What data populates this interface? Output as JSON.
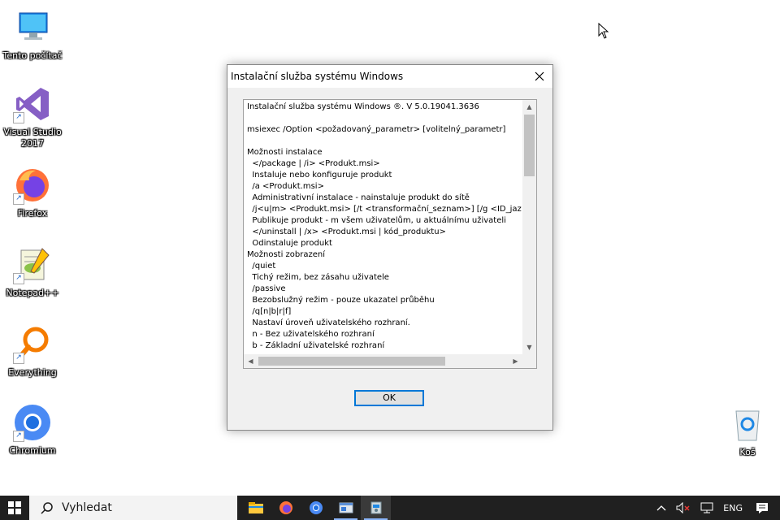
{
  "desktop": {
    "icons": [
      {
        "label": "Tento počítač",
        "icon": "computer-icon"
      },
      {
        "label": "Visual Studio 2017",
        "icon": "visual-studio-icon"
      },
      {
        "label": "Firefox",
        "icon": "firefox-icon"
      },
      {
        "label": "Notepad++",
        "icon": "notepadpp-icon"
      },
      {
        "label": "Everything",
        "icon": "everything-icon"
      },
      {
        "label": "Chromium",
        "icon": "chromium-icon"
      },
      {
        "label": "Koš",
        "icon": "recycle-bin-icon"
      }
    ]
  },
  "dialog": {
    "title": "Instalační služba systému Windows",
    "close_icon": "close-icon",
    "text_lines": [
      "Instalační služba systému Windows ®. V 5.0.19041.3636",
      "",
      "msiexec /Option <požadovaný_parametr> [volitelný_parametr]",
      "",
      "Možnosti instalace",
      "  </package | /i> <Produkt.msi>",
      "  Instaluje nebo konfiguruje produkt",
      "  /a <Produkt.msi>",
      "  Administrativní instalace - nainstaluje produkt do sítě",
      "  /j<u|m> <Produkt.msi> [/t <transformační_seznam>] [/g <ID_jazyka>]",
      "  Publikuje produkt - m všem uživatelům, u aktuálnímu uživateli",
      "  </uninstall | /x> <Produkt.msi | kód_produktu>",
      "  Odinstaluje produkt",
      "Možnosti zobrazení",
      "  /quiet",
      "  Tichý režim, bez zásahu uživatele",
      "  /passive",
      "  Bezobslužný režim - pouze ukazatel průběhu",
      "  /q[n|b|r|f]",
      "  Nastaví úroveň uživatelského rozhraní.",
      "  n - Bez uživatelského rozhraní",
      "  b - Základní uživatelské rozhraní"
    ],
    "ok_label": "OK"
  },
  "taskbar": {
    "search_placeholder": "Vyhledat",
    "apps": [
      "file-explorer-icon",
      "firefox-icon",
      "chromium-icon",
      "window-app-icon",
      "installer-icon"
    ],
    "language": "ENG"
  }
}
